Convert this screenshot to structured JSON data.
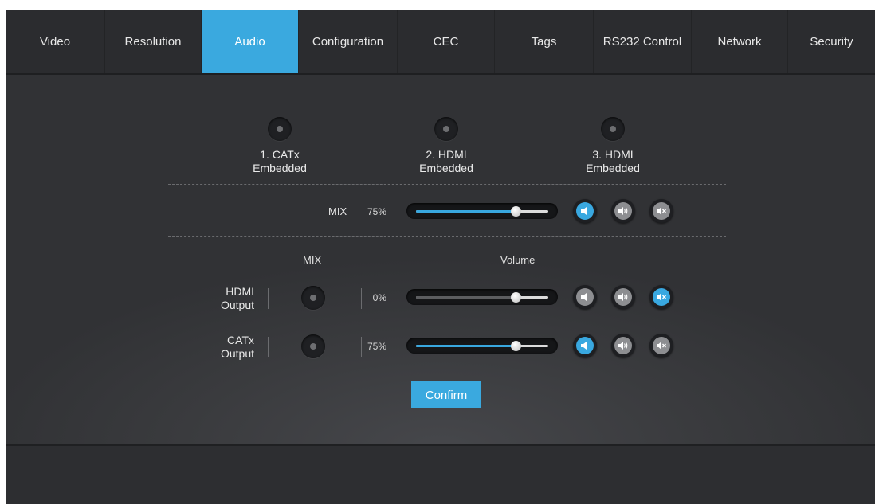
{
  "tabs": [
    {
      "label": "Video"
    },
    {
      "label": "Resolution"
    },
    {
      "label": "Audio"
    },
    {
      "label": "Configuration"
    },
    {
      "label": "CEC"
    },
    {
      "label": "Tags"
    },
    {
      "label": "RS232 Control"
    },
    {
      "label": "Network"
    },
    {
      "label": "Security"
    }
  ],
  "active_tab": "Audio",
  "inputs": [
    {
      "line1": "1. CATx",
      "line2": "Embedded"
    },
    {
      "line1": "2. HDMI",
      "line2": "Embedded"
    },
    {
      "line1": "3. HDMI",
      "line2": "Embedded"
    }
  ],
  "mix_row": {
    "label": "MIX",
    "percent": "75%",
    "level": 0.75,
    "mode": "speaker-low"
  },
  "headers": {
    "mix": "MIX",
    "volume": "Volume"
  },
  "outputs": [
    {
      "line1": "HDMI",
      "line2": "Output",
      "percent": "0%",
      "level": 0.75,
      "mode": "mute"
    },
    {
      "line1": "CATx",
      "line2": "Output",
      "percent": "75%",
      "level": 0.75,
      "mode": "speaker-low"
    }
  ],
  "buttons": {
    "confirm": "Confirm"
  },
  "colors": {
    "accent": "#3aa9df",
    "background": "#2e2f32",
    "inactive_button": "#8d8e91"
  },
  "icons": [
    "speaker-low-icon",
    "speaker-high-icon",
    "speaker-mute-icon"
  ]
}
